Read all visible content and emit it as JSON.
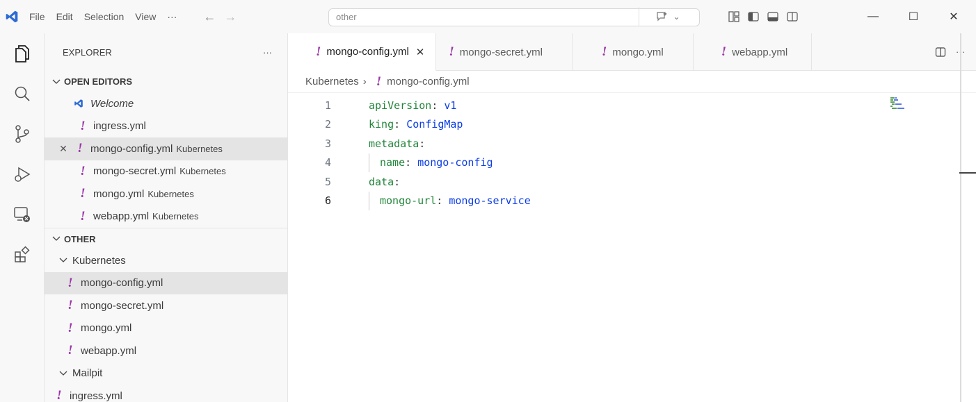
{
  "titlebar": {
    "menu": [
      "File",
      "Edit",
      "Selection",
      "View",
      "···"
    ],
    "command_center": "other"
  },
  "sidebar": {
    "title": "EXPLORER",
    "more": "···",
    "open_editors": {
      "label": "OPEN EDITORS",
      "items": [
        {
          "name": "Welcome",
          "desc": ""
        },
        {
          "name": "ingress.yml",
          "desc": ""
        },
        {
          "name": "mongo-config.yml",
          "desc": "Kubernetes"
        },
        {
          "name": "mongo-secret.yml",
          "desc": "Kubernetes"
        },
        {
          "name": "mongo.yml",
          "desc": "Kubernetes"
        },
        {
          "name": "webapp.yml",
          "desc": "Kubernetes"
        }
      ]
    },
    "other": {
      "label": "OTHER",
      "folder_kubernetes": "Kubernetes",
      "kubernetes_files": [
        "mongo-config.yml",
        "mongo-secret.yml",
        "mongo.yml",
        "webapp.yml"
      ],
      "folder_mailpit": "Mailpit",
      "root_file": "ingress.yml"
    }
  },
  "tabs": [
    {
      "label": "mongo-config.yml",
      "active": true
    },
    {
      "label": "mongo-secret.yml",
      "active": false
    },
    {
      "label": "mongo.yml",
      "active": false
    },
    {
      "label": "webapp.yml",
      "active": false
    }
  ],
  "breadcrumb": {
    "folder": "Kubernetes",
    "file": "mongo-config.yml"
  },
  "code": {
    "lines": [
      {
        "n": "1",
        "key": "apiVersion",
        "value": "v1",
        "indent": false
      },
      {
        "n": "2",
        "key": "king",
        "value": "ConfigMap",
        "indent": false
      },
      {
        "n": "3",
        "key": "metadata",
        "value": "",
        "indent": false
      },
      {
        "n": "4",
        "key": "name",
        "value": "mongo-config",
        "indent": true
      },
      {
        "n": "5",
        "key": "data",
        "value": "",
        "indent": false
      },
      {
        "n": "6",
        "key": "mongo-url",
        "value": "mongo-service",
        "indent": true
      }
    ]
  },
  "colors": {
    "yaml_icon": "#9b35a8",
    "yaml_key": "#22863a",
    "yaml_value": "#0b3ce6",
    "vscode_blue": "#2c6bd6"
  }
}
